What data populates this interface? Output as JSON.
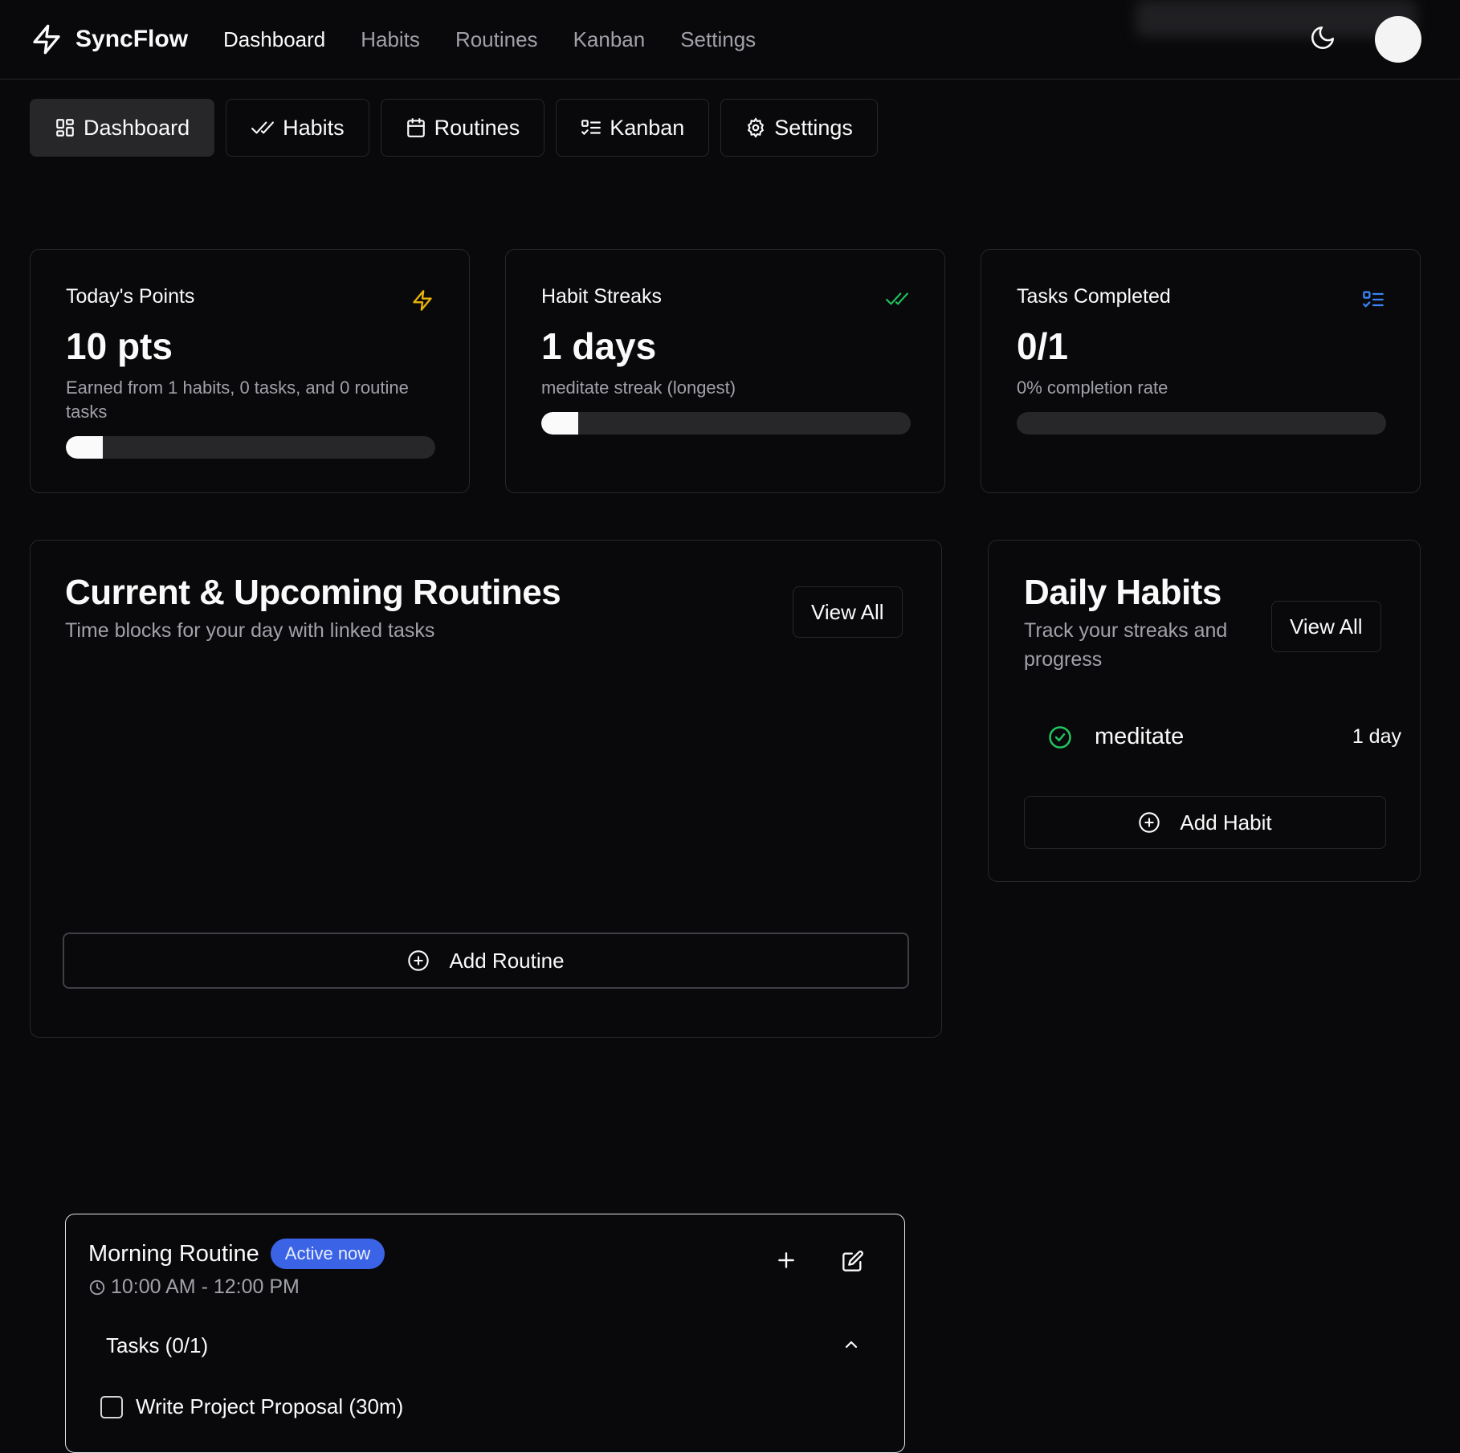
{
  "app": {
    "name": "SyncFlow"
  },
  "topnav": [
    "Dashboard",
    "Habits",
    "Routines",
    "Kanban",
    "Settings"
  ],
  "tabs": [
    {
      "label": "Dashboard",
      "icon": "dashboard-grid-icon"
    },
    {
      "label": "Habits",
      "icon": "double-check-icon"
    },
    {
      "label": "Routines",
      "icon": "calendar-icon"
    },
    {
      "label": "Kanban",
      "icon": "list-check-icon"
    },
    {
      "label": "Settings",
      "icon": "gear-icon"
    }
  ],
  "stats": {
    "points": {
      "title": "Today's Points",
      "value": "10 pts",
      "sub": "Earned from 1 habits, 0 tasks, and 0 routine tasks",
      "progress": 0.1,
      "icon": "zap-icon",
      "icon_color": "#eab308"
    },
    "streaks": {
      "title": "Habit Streaks",
      "value": "1 days",
      "sub": "meditate streak (longest)",
      "progress": 0.1,
      "icon": "double-check-icon",
      "icon_color": "#22c55e"
    },
    "tasks": {
      "title": "Tasks Completed",
      "value": "0/1",
      "sub": "0% completion rate",
      "progress": 0.0,
      "icon": "list-check-icon",
      "icon_color": "#3b82f6"
    }
  },
  "routines": {
    "title": "Current & Upcoming Routines",
    "subtitle": "Time blocks for your day with linked tasks",
    "view_all": "View All",
    "routine": {
      "name": "Morning Routine",
      "badge": "Active now",
      "time": "10:00 AM - 12:00 PM",
      "tasks_header": "Tasks (0/1)",
      "tasks": [
        {
          "label": "Write Project Proposal (30m)",
          "done": false
        }
      ]
    },
    "add_button": "Add Routine"
  },
  "habits": {
    "title": "Daily Habits",
    "subtitle": "Track your streaks and progress",
    "view_all": "View All",
    "items": [
      {
        "name": "meditate",
        "streak": "1 day",
        "done": true
      }
    ],
    "add_button": "Add Habit"
  }
}
